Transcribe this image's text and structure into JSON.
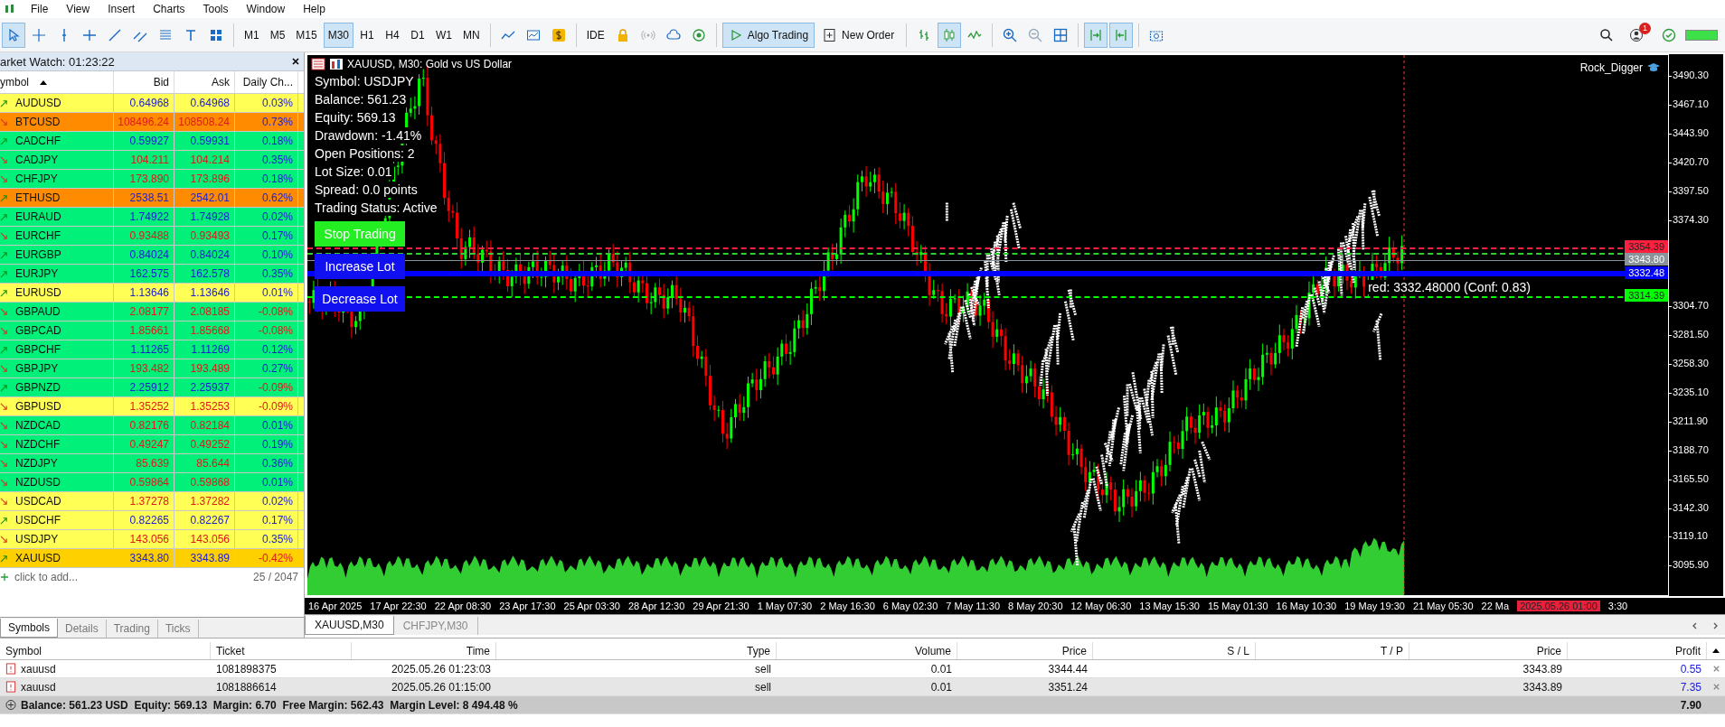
{
  "menu": [
    "File",
    "View",
    "Insert",
    "Charts",
    "Tools",
    "Window",
    "Help"
  ],
  "toolbar": {
    "tools": [
      {
        "kind": "cursor",
        "selected": true
      },
      {
        "kind": "crosshair",
        "selected": false
      },
      {
        "kind": "vline",
        "selected": false
      },
      {
        "kind": "hline",
        "selected": false
      },
      {
        "kind": "trendline",
        "selected": false
      },
      {
        "kind": "channel",
        "selected": false
      },
      {
        "kind": "fibo",
        "selected": false
      },
      {
        "kind": "text",
        "selected": false
      },
      {
        "kind": "shapes",
        "selected": false
      }
    ],
    "timeframes": [
      {
        "label": "M1",
        "selected": false
      },
      {
        "label": "M5",
        "selected": false
      },
      {
        "label": "M15",
        "selected": false
      },
      {
        "label": "M30",
        "selected": true
      },
      {
        "label": "H1",
        "selected": false
      },
      {
        "label": "H4",
        "selected": false
      },
      {
        "label": "D1",
        "selected": false
      },
      {
        "label": "W1",
        "selected": false
      },
      {
        "label": "MN",
        "selected": false
      }
    ],
    "ide": "IDE",
    "algo_trading": {
      "label": "Algo Trading",
      "on": true
    },
    "new_order": "New Order",
    "chart_styles": [
      {
        "kind": "bars",
        "selected": false
      },
      {
        "kind": "candles",
        "selected": true
      },
      {
        "kind": "line",
        "selected": false
      }
    ],
    "scroll_tools": [
      {
        "kind": "autoscroll",
        "selected": true
      },
      {
        "kind": "shift",
        "selected": true
      }
    ],
    "notification_badge": "1"
  },
  "market_watch": {
    "title": "arket Watch: 01:23:22",
    "columns": [
      "ymbol",
      "Bid",
      "Ask",
      "Daily Ch..."
    ],
    "rows": [
      {
        "symbol": "AUDUSD",
        "bid": "0.64968",
        "ask": "0.64968",
        "change": "0.03%",
        "up": true,
        "change_down": false,
        "color": "#ffff55"
      },
      {
        "symbol": "BTCUSD",
        "bid": "108496.24",
        "ask": "108508.24",
        "change": "0.73%",
        "up": false,
        "change_down": false,
        "color": "#ff8c00"
      },
      {
        "symbol": "CADCHF",
        "bid": "0.59927",
        "ask": "0.59931",
        "change": "0.18%",
        "up": true,
        "change_down": false,
        "color": "#00f07a"
      },
      {
        "symbol": "CADJPY",
        "bid": "104.211",
        "ask": "104.214",
        "change": "0.35%",
        "up": false,
        "change_down": false,
        "color": "#00f07a"
      },
      {
        "symbol": "CHFJPY",
        "bid": "173.890",
        "ask": "173.896",
        "change": "0.18%",
        "up": false,
        "change_down": false,
        "color": "#00f07a"
      },
      {
        "symbol": "ETHUSD",
        "bid": "2538.51",
        "ask": "2542.01",
        "change": "0.62%",
        "up": true,
        "change_down": false,
        "color": "#ff8c00"
      },
      {
        "symbol": "EURAUD",
        "bid": "1.74922",
        "ask": "1.74928",
        "change": "0.02%",
        "up": true,
        "change_down": false,
        "color": "#00f07a"
      },
      {
        "symbol": "EURCHF",
        "bid": "0.93488",
        "ask": "0.93493",
        "change": "0.17%",
        "up": false,
        "change_down": false,
        "color": "#00f07a"
      },
      {
        "symbol": "EURGBP",
        "bid": "0.84024",
        "ask": "0.84024",
        "change": "0.10%",
        "up": true,
        "change_down": false,
        "color": "#00f07a"
      },
      {
        "symbol": "EURJPY",
        "bid": "162.575",
        "ask": "162.578",
        "change": "0.35%",
        "up": true,
        "change_down": false,
        "color": "#00f07a"
      },
      {
        "symbol": "EURUSD",
        "bid": "1.13646",
        "ask": "1.13646",
        "change": "0.01%",
        "up": true,
        "change_down": false,
        "color": "#ffff55"
      },
      {
        "symbol": "GBPAUD",
        "bid": "2.08177",
        "ask": "2.08185",
        "change": "-0.08%",
        "up": false,
        "change_down": true,
        "color": "#00f07a"
      },
      {
        "symbol": "GBPCAD",
        "bid": "1.85661",
        "ask": "1.85668",
        "change": "-0.08%",
        "up": false,
        "change_down": true,
        "color": "#00f07a"
      },
      {
        "symbol": "GBPCHF",
        "bid": "1.11265",
        "ask": "1.11269",
        "change": "0.12%",
        "up": true,
        "change_down": false,
        "color": "#00f07a"
      },
      {
        "symbol": "GBPJPY",
        "bid": "193.482",
        "ask": "193.489",
        "change": "0.27%",
        "up": false,
        "change_down": false,
        "color": "#00f07a"
      },
      {
        "symbol": "GBPNZD",
        "bid": "2.25912",
        "ask": "2.25937",
        "change": "-0.09%",
        "up": true,
        "change_down": true,
        "color": "#00f07a"
      },
      {
        "symbol": "GBPUSD",
        "bid": "1.35252",
        "ask": "1.35253",
        "change": "-0.09%",
        "up": false,
        "change_down": true,
        "color": "#ffff55"
      },
      {
        "symbol": "NZDCAD",
        "bid": "0.82176",
        "ask": "0.82184",
        "change": "0.01%",
        "up": false,
        "change_down": false,
        "color": "#00f07a"
      },
      {
        "symbol": "NZDCHF",
        "bid": "0.49247",
        "ask": "0.49252",
        "change": "0.19%",
        "up": false,
        "change_down": false,
        "color": "#00f07a"
      },
      {
        "symbol": "NZDJPY",
        "bid": "85.639",
        "ask": "85.644",
        "change": "0.36%",
        "up": false,
        "change_down": false,
        "color": "#00f07a"
      },
      {
        "symbol": "NZDUSD",
        "bid": "0.59864",
        "ask": "0.59868",
        "change": "0.01%",
        "up": false,
        "change_down": false,
        "color": "#00f07a"
      },
      {
        "symbol": "USDCAD",
        "bid": "1.37278",
        "ask": "1.37282",
        "change": "0.02%",
        "up": false,
        "change_down": false,
        "color": "#ffff55"
      },
      {
        "symbol": "USDCHF",
        "bid": "0.82265",
        "ask": "0.82267",
        "change": "0.17%",
        "up": true,
        "change_down": false,
        "color": "#ffff55"
      },
      {
        "symbol": "USDJPY",
        "bid": "143.056",
        "ask": "143.056",
        "change": "0.35%",
        "up": false,
        "change_down": false,
        "color": "#ffff55"
      },
      {
        "symbol": "XAUUSD",
        "bid": "3343.80",
        "ask": "3343.89",
        "change": "-0.42%",
        "up": true,
        "change_down": true,
        "color": "#ffd000"
      }
    ],
    "add_label": "click to add...",
    "count": "25 / 2047",
    "tabs": [
      {
        "label": "Symbols",
        "selected": true
      },
      {
        "label": "Details",
        "selected": false
      },
      {
        "label": "Trading",
        "selected": false
      },
      {
        "label": "Ticks",
        "selected": false
      }
    ]
  },
  "chart": {
    "title": "XAUUSD, M30:  Gold vs US Dollar",
    "ea_name": "Rock_Digger",
    "info_lines": [
      "Symbol: USDJPY",
      "Balance: 561.23",
      "Equity: 569.13",
      "Drawdown: -1.41%",
      "Open Positions: 2",
      "Lot Size: 0.01",
      "Spread: 0.0 points",
      "Trading Status: Active"
    ],
    "buttons": [
      {
        "label": "Stop Trading",
        "kind": "stop"
      },
      {
        "label": "Increase Lot",
        "kind": "lot"
      },
      {
        "label": "Decrease Lot",
        "kind": "lot"
      }
    ],
    "prediction": "red: 3332.48000 (Conf: 0.83)",
    "price_lines": [
      {
        "kind": "dashed",
        "color": "#ff2040",
        "label": "3354.39"
      },
      {
        "kind": "dashed",
        "color": "#32cd32"
      },
      {
        "kind": "solid",
        "color": "#8a939a",
        "label": "3343.80"
      },
      {
        "kind": "thick",
        "color": "#0000ff",
        "label": "3332.48"
      },
      {
        "kind": "dashed",
        "color": "#00ff00",
        "label": "3314.39"
      }
    ],
    "price_axis": [
      "3490.30",
      "3467.10",
      "3443.90",
      "3420.70",
      "3397.50",
      "3374.30",
      "3304.70",
      "3281.50",
      "3258.30",
      "3235.10",
      "3211.90",
      "3188.70",
      "3165.50",
      "3142.30",
      "3119.10",
      "3095.90"
    ],
    "time_axis": [
      "16 Apr 2025",
      "17 Apr 22:30",
      "22 Apr 08:30",
      "23 Apr 17:30",
      "25 Apr 03:30",
      "28 Apr 12:30",
      "29 Apr 21:30",
      "1 May 07:30",
      "2 May 16:30",
      "6 May 02:30",
      "7 May 11:30",
      "8 May 20:30",
      "12 May 06:30",
      "13 May 15:30",
      "15 May 01:30",
      "16 May 10:30",
      "19 May 19:30",
      "21 May 05:30",
      "22 Ma"
    ],
    "cursor_time": "2025.05.26 01:00",
    "time_tail": "3:30",
    "tabs": [
      {
        "label": "XAUUSD,M30",
        "selected": true
      },
      {
        "label": "CHFJPY,M30",
        "selected": false
      }
    ]
  },
  "trades": {
    "columns": [
      "Symbol",
      "Ticket",
      "Time",
      "Type",
      "Volume",
      "Price",
      "S / L",
      "T / P",
      "Price",
      "Profit"
    ],
    "rows": [
      {
        "cells": [
          "xauusd",
          "1081898375",
          "2025.05.26 01:23:03",
          "sell",
          "0.01",
          "3344.44",
          "",
          "",
          "3343.89",
          "0.55"
        ],
        "selected": false
      },
      {
        "cells": [
          "xauusd",
          "1081886614",
          "2025.05.26 01:15:00",
          "sell",
          "0.01",
          "3351.24",
          "",
          "",
          "3343.89",
          "7.35"
        ],
        "selected": true
      }
    ],
    "summary": "Balance: 561.23 USD  Equity: 569.13  Margin: 6.70  Free Margin: 562.43  Margin Level: 8 494.48 %",
    "total": "7.90"
  }
}
